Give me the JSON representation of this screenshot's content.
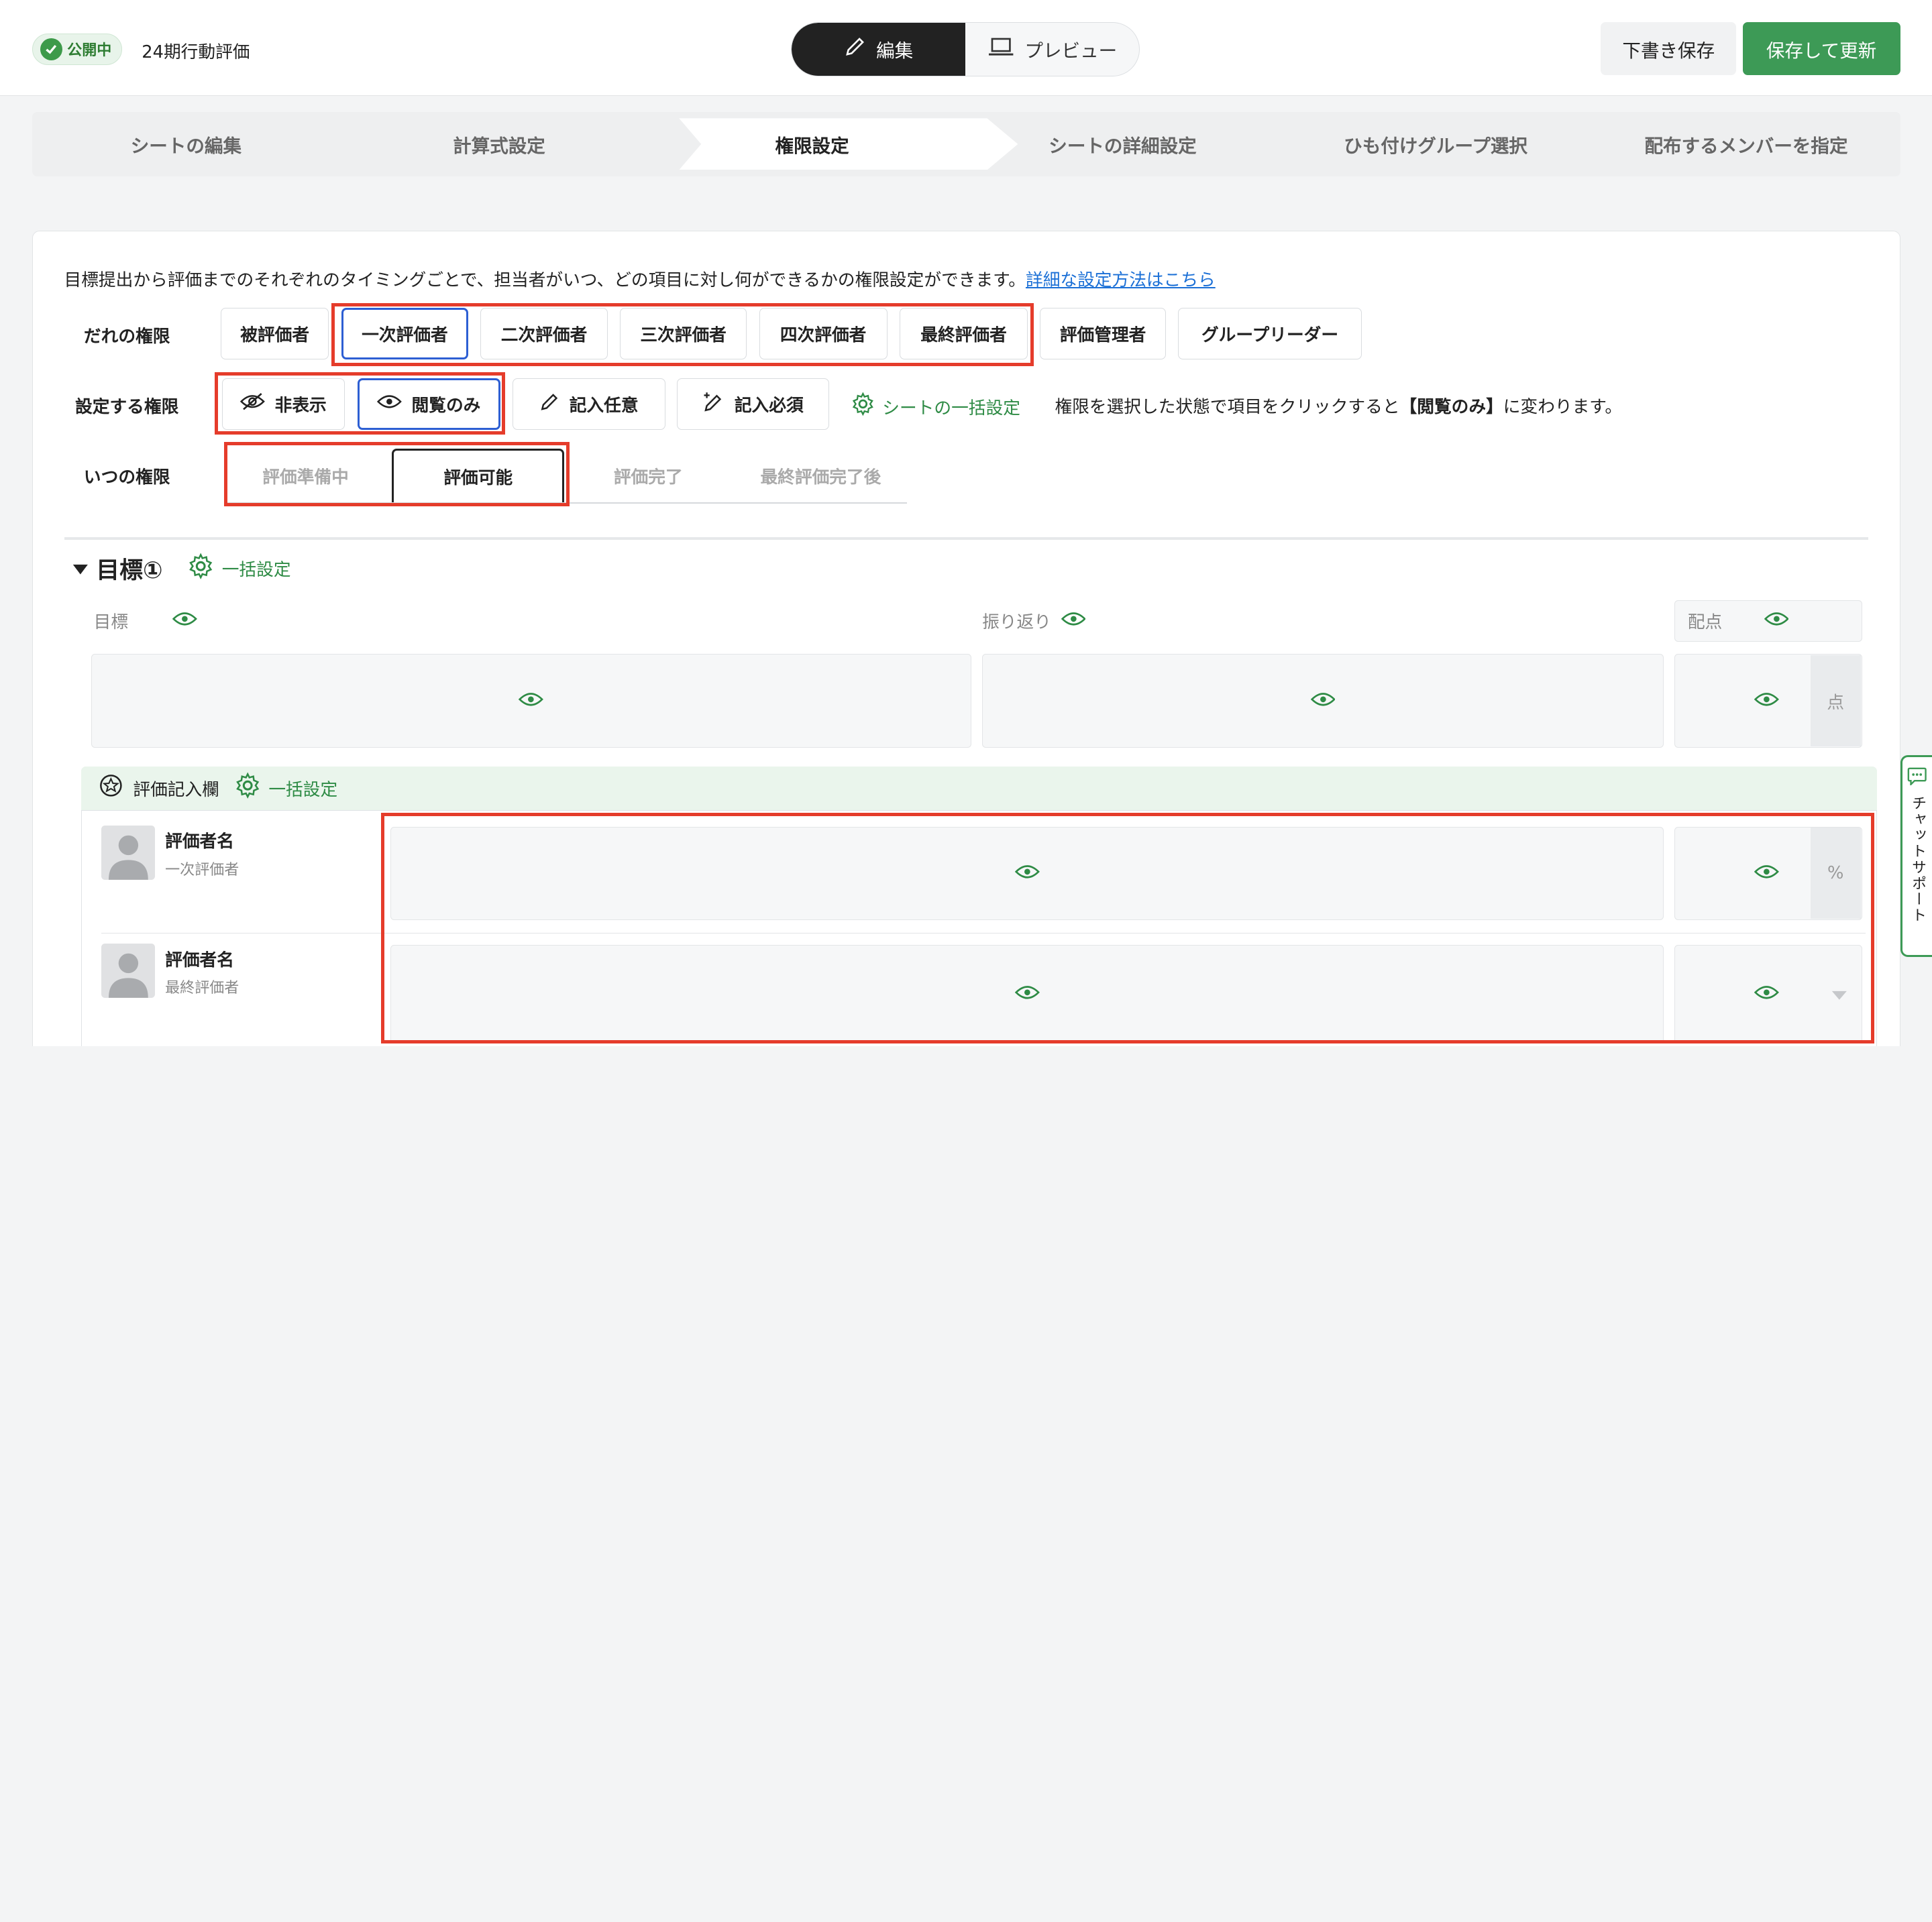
{
  "header": {
    "status": "公開中",
    "sheet_title": "24期行動評価",
    "modes": {
      "edit": "編集",
      "preview": "プレビュー"
    },
    "draft_save": "下書き保存",
    "save_update": "保存して更新"
  },
  "steps": [
    "シートの編集",
    "計算式設定",
    "権限設定",
    "シートの詳細設定",
    "ひも付けグループ選択",
    "配布するメンバーを指定"
  ],
  "intro": {
    "text": "目標提出から評価までのそれぞれのタイミングごとで、担当者がいつ、どの項目に対し何ができるかの権限設定ができます。",
    "link": "詳細な設定方法はこちら"
  },
  "who": {
    "label": "だれの権限",
    "options": [
      "被評価者",
      "一次評価者",
      "二次評価者",
      "三次評価者",
      "四次評価者",
      "最終評価者",
      "評価管理者",
      "グループリーダー"
    ],
    "selected": "一次評価者"
  },
  "permission": {
    "label": "設定する権限",
    "options": [
      "非表示",
      "閲覧のみ",
      "記入任意",
      "記入必須"
    ],
    "selected": "閲覧のみ",
    "bulk": "シートの一括設定",
    "hint_pre": "権限を選択した状態で項目をクリックすると",
    "hint_bold": "【閲覧のみ】",
    "hint_post": "に変わります。"
  },
  "when": {
    "label": "いつの権限",
    "tabs": [
      "評価準備中",
      "評価可能",
      "評価完了",
      "最終評価完了後"
    ],
    "selected": "評価可能"
  },
  "section": {
    "title": "目標①",
    "bulk": "一括設定",
    "columns": {
      "goal": "目標",
      "review": "振り返り",
      "score": "配点"
    },
    "unit_points": "点"
  },
  "evaluation": {
    "title": "評価記入欄",
    "bulk": "一括設定",
    "rows": [
      {
        "name": "評価者名",
        "role": "一次評価者",
        "unit": "%"
      },
      {
        "name": "評価者名",
        "role": "最終評価者",
        "unit": ""
      }
    ]
  },
  "chat_support": "チャットサポート",
  "colors": {
    "accent": "#3d9a56",
    "highlight": "#e53c2b",
    "selected_border": "#2d5fd3"
  }
}
